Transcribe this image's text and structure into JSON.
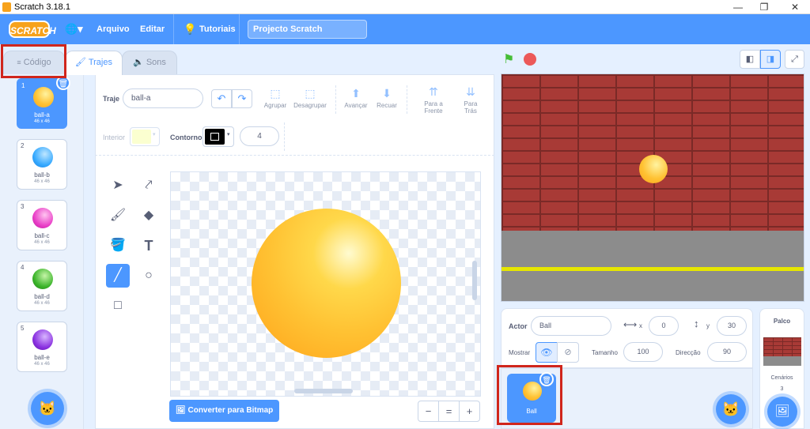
{
  "window": {
    "title": "Scratch 3.18.1",
    "minimize": "—",
    "maximize": "❐",
    "close": "✕"
  },
  "menubar": {
    "logo": "SCRATCH",
    "globe": "🌐▾",
    "file": "Arquivo",
    "edit": "Editar",
    "tutorials_icon": "💡",
    "tutorials": "Tutoriais",
    "project_title": "Projecto Scratch"
  },
  "tabs": {
    "code": "Código",
    "costumes": "Trajes",
    "sounds": "Sons"
  },
  "costumes": [
    {
      "num": "1",
      "name": "ball-a",
      "size": "46 x 46",
      "color": "#ffc233",
      "selected": true
    },
    {
      "num": "2",
      "name": "ball-b",
      "size": "46 x 46",
      "color": "#35a9ff"
    },
    {
      "num": "3",
      "name": "ball-c",
      "size": "46 x 46",
      "color": "#e93ec7"
    },
    {
      "num": "4",
      "name": "ball-d",
      "size": "46 x 46",
      "color": "#3bb42a"
    },
    {
      "num": "5",
      "name": "ball-e",
      "size": "46 x 46",
      "color": "#8a31e0"
    }
  ],
  "editor": {
    "costume_label": "Traje",
    "costume_name": "ball-a",
    "group": "Agrupar",
    "ungroup": "Desagrupar",
    "forward": "Avançar",
    "backward": "Recuar",
    "front_1": "Para a",
    "front_2": "Frente",
    "back_1": "Para",
    "back_2": "Trás",
    "fill_label": "Interior",
    "outline_label": "Contorno",
    "outline_width": "4",
    "convert_bitmap": "Converter para Bitmap",
    "zoom_out": "−",
    "zoom_reset": "=",
    "zoom_in": "+"
  },
  "sprite_info": {
    "actor_label": "Actor",
    "actor_name": "Ball",
    "x_label": "x",
    "x_value": "0",
    "y_label": "y",
    "y_value": "30",
    "show_label": "Mostrar",
    "size_label": "Tamanho",
    "size_value": "100",
    "direction_label": "Direcção",
    "direction_value": "90"
  },
  "sprites": [
    {
      "name": "Ball"
    }
  ],
  "stage_pane": {
    "title": "Palco",
    "backdrops_label": "Cenários",
    "backdrops_count": "3"
  }
}
